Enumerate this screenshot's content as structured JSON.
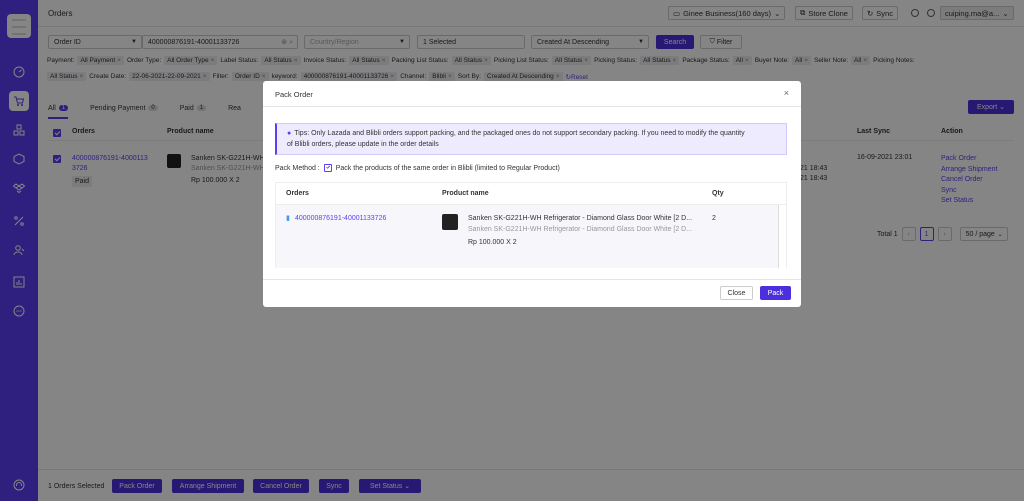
{
  "app": {
    "page_title": "Orders"
  },
  "topbar": {
    "business": "Ginee Business(160 days)",
    "store_clone": "Store Clone",
    "sync": "Sync",
    "user": "cuiping.ma@a..."
  },
  "filters": {
    "field": "Order ID",
    "search_value": "400000876191-40001133726",
    "region_placeholder": "Country/Region",
    "selected": "1 Selected",
    "sort": "Created At Descending",
    "search_btn": "Search",
    "filter_btn": "Filter",
    "row1": [
      {
        "label": "Payment:",
        "value": "All Payment"
      },
      {
        "label": "Order Type:",
        "value": "All Order Type"
      },
      {
        "label": "Label Status:",
        "value": "All Status"
      },
      {
        "label": "Invoice Status:",
        "value": "All Status"
      },
      {
        "label": "Packing List Status:",
        "value": "All Status"
      },
      {
        "label": "Picking List Status:",
        "value": "All Status"
      },
      {
        "label": "Picking Status:",
        "value": "All Status"
      },
      {
        "label": "Package Status:",
        "value": "All"
      },
      {
        "label": "Buyer Note:",
        "value": "All"
      },
      {
        "label": "Seller Note:",
        "value": "All"
      },
      {
        "label": "Picking Notes:",
        "value": ""
      }
    ],
    "row2": [
      {
        "label": "",
        "value": "All Status"
      },
      {
        "label": "Create Date:",
        "value": "22-06-2021-22-09-2021"
      },
      {
        "label": "Filter:",
        "value": "Order ID"
      },
      {
        "label": "keyword:",
        "value": "400000876191-40001133726"
      },
      {
        "label": "Channel:",
        "value": "Blibli"
      },
      {
        "label": "Sort By:",
        "value": "Created At Descending"
      }
    ],
    "reset": "Reset"
  },
  "tabs": [
    {
      "label": "All",
      "count": "1"
    },
    {
      "label": "Pending Payment",
      "count": "0"
    },
    {
      "label": "Paid",
      "count": "1"
    },
    {
      "label": "Rea",
      "count": ""
    }
  ],
  "export": "Export",
  "table": {
    "headers": {
      "orders": "Orders",
      "product": "Product name",
      "last_sync": "Last Sync",
      "action": "Action"
    },
    "row": {
      "order_id_line1": "400000876191-4000113",
      "order_id_line2": "3726",
      "status": "Paid",
      "product_line1": "Sanken SK-G221H-WH",
      "product_line2": "Sanken SK-G221H-WH",
      "price_qty": "Rp 100.000 X 2",
      "time1": "21 18:43",
      "time2": "21 18:43",
      "last_sync": "16-09-2021 23:01",
      "actions": [
        "Pack Order",
        "Arrange Shipment",
        "Cancel Order",
        "Sync",
        "Set Status"
      ]
    }
  },
  "pager": {
    "total": "Total 1",
    "page": "1",
    "per_page": "50 / page"
  },
  "bottom": {
    "selected": "1 Orders Selected",
    "buttons": [
      "Pack Order",
      "Arrange Shipment",
      "Cancel Order",
      "Sync",
      "Set Status"
    ]
  },
  "modal": {
    "title": "Pack Order",
    "close_x": "×",
    "tips_line1": "Tips: Only Lazada and Blibli orders support packing, and the packaged ones do not support secondary packing. If you need to modify the quantity",
    "tips_line2": "of Blibli orders, please update in the order details",
    "pack_method_label": "Pack Method :",
    "pack_method_option": "Pack the products of the same order in Blibli (limited to Regular Product)",
    "headers": {
      "orders": "Orders",
      "product": "Product name",
      "qty": "Qty"
    },
    "row": {
      "order_id": "400000876191-40001133726",
      "product_title": "Sanken SK-G221H-WH Refrigerator - Diamond Glass Door White [2 D...",
      "product_sub": "Sanken SK-G221H-WH Refrigerator - Diamond Glass Door White [2 D...",
      "price_qty": "Rp 100.000 X 2",
      "qty": "2"
    },
    "close_btn": "Close",
    "pack_btn": "Pack"
  },
  "colors": {
    "accent": "#5b3ff5",
    "primary_button": "#4b2fdc"
  }
}
